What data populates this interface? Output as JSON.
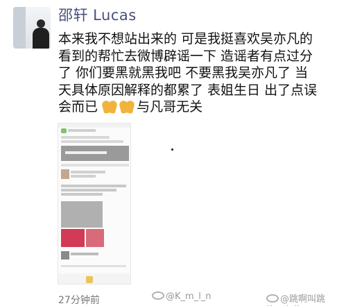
{
  "post": {
    "username": "邵轩 Lucas",
    "body_lines": [
      "本来我不想站出来的 可是我挺喜欢吴亦凡的",
      "看到的帮忙去微博辟谣一下  造谣者有点过分",
      "了  你们要黑就黑我吧 不要黑我吴亦凡了 当",
      "天具体原因解释的都累了  表姐生日 出了点误"
    ],
    "last_line_text": "会而已",
    "last_line_suffix": "与凡哥无关",
    "emoji_icon": "pray-hands-icon",
    "timestamp": "27分钟前"
  },
  "watermarks": [
    {
      "text": "@K_m_l_n",
      "icon": "weibo-icon"
    },
    {
      "text": "@跳啊叫跳Kendall",
      "icon": "weibo-icon"
    }
  ],
  "colors": {
    "username": "#4a4f7c",
    "body": "#111111",
    "timestamp": "#777777",
    "emoji": "#f0b43c"
  }
}
